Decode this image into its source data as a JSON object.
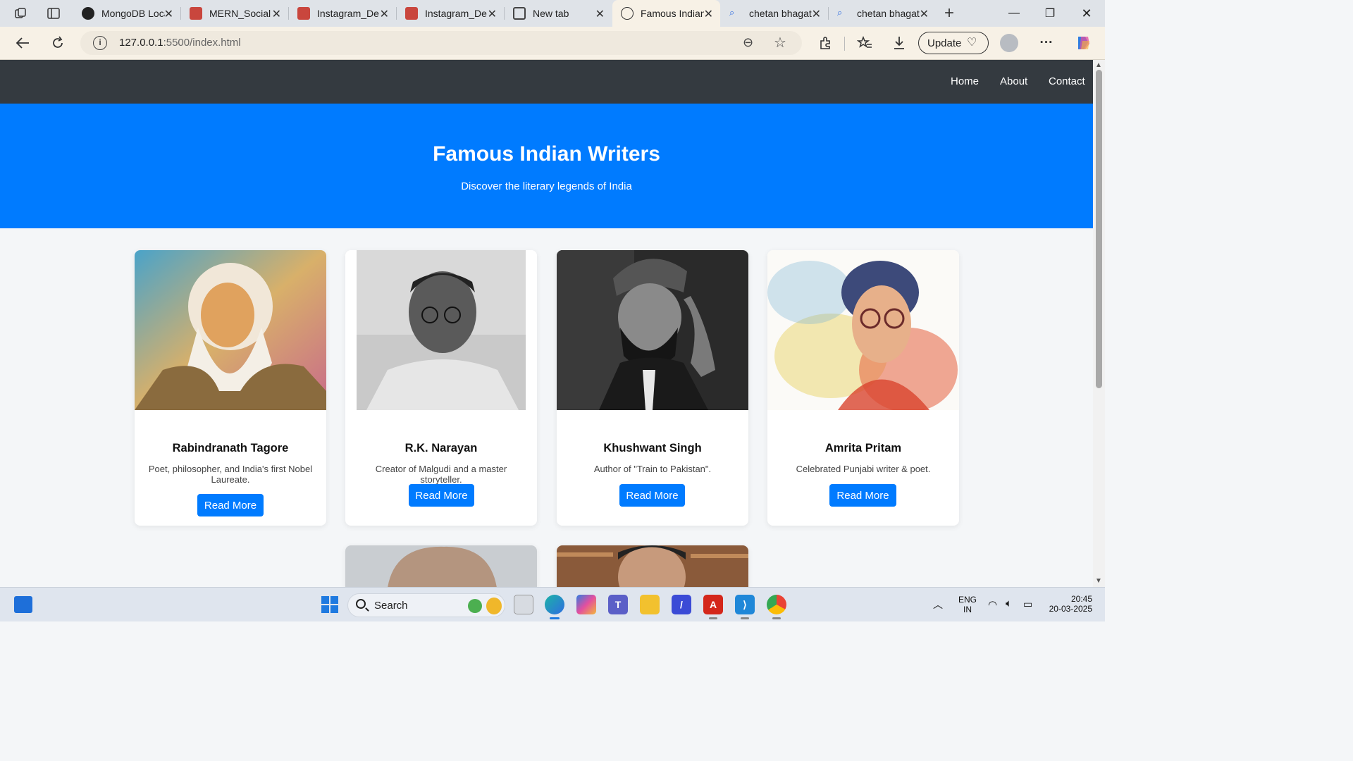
{
  "browser": {
    "tabs": [
      {
        "title": "MongoDB Local",
        "color": "#222222"
      },
      {
        "title": "MERN_Social",
        "color": "#c9463d"
      },
      {
        "title": "Instagram_De",
        "color": "#c9463d"
      },
      {
        "title": "Instagram_De",
        "color": "#c9463d"
      },
      {
        "title": "New tab",
        "color": "#444444"
      },
      {
        "title": "Famous Indian Writers",
        "color": "#333333"
      },
      {
        "title": "chetan bhagat",
        "color": "#2f6de1"
      },
      {
        "title": "chetan bhagat",
        "color": "#2f6de1"
      }
    ],
    "url_host": "127.0.0.1",
    "url_path": ":5500/index.html",
    "update_label": "Update"
  },
  "page": {
    "nav": {
      "home": "Home",
      "about": "About",
      "contact": "Contact"
    },
    "hero": {
      "title": "Famous Indian Writers",
      "subtitle": "Discover the literary legends of India"
    },
    "writers": [
      {
        "name": "Rabindranath Tagore",
        "desc": "Poet, philosopher, and India's first Nobel Laureate.",
        "button": "Read More"
      },
      {
        "name": "R.K. Narayan",
        "desc": "Creator of Malgudi and a master storyteller.",
        "button": "Read More"
      },
      {
        "name": "Khushwant Singh",
        "desc": "Author of \"Train to Pakistan\".",
        "button": "Read More"
      },
      {
        "name": "Amrita Pritam",
        "desc": "Celebrated Punjabi writer & poet.",
        "button": "Read More"
      }
    ]
  },
  "taskbar": {
    "search_label": "Search",
    "lang_line1": "ENG",
    "lang_line2": "IN",
    "time": "20:45",
    "date": "20-03-2025"
  }
}
